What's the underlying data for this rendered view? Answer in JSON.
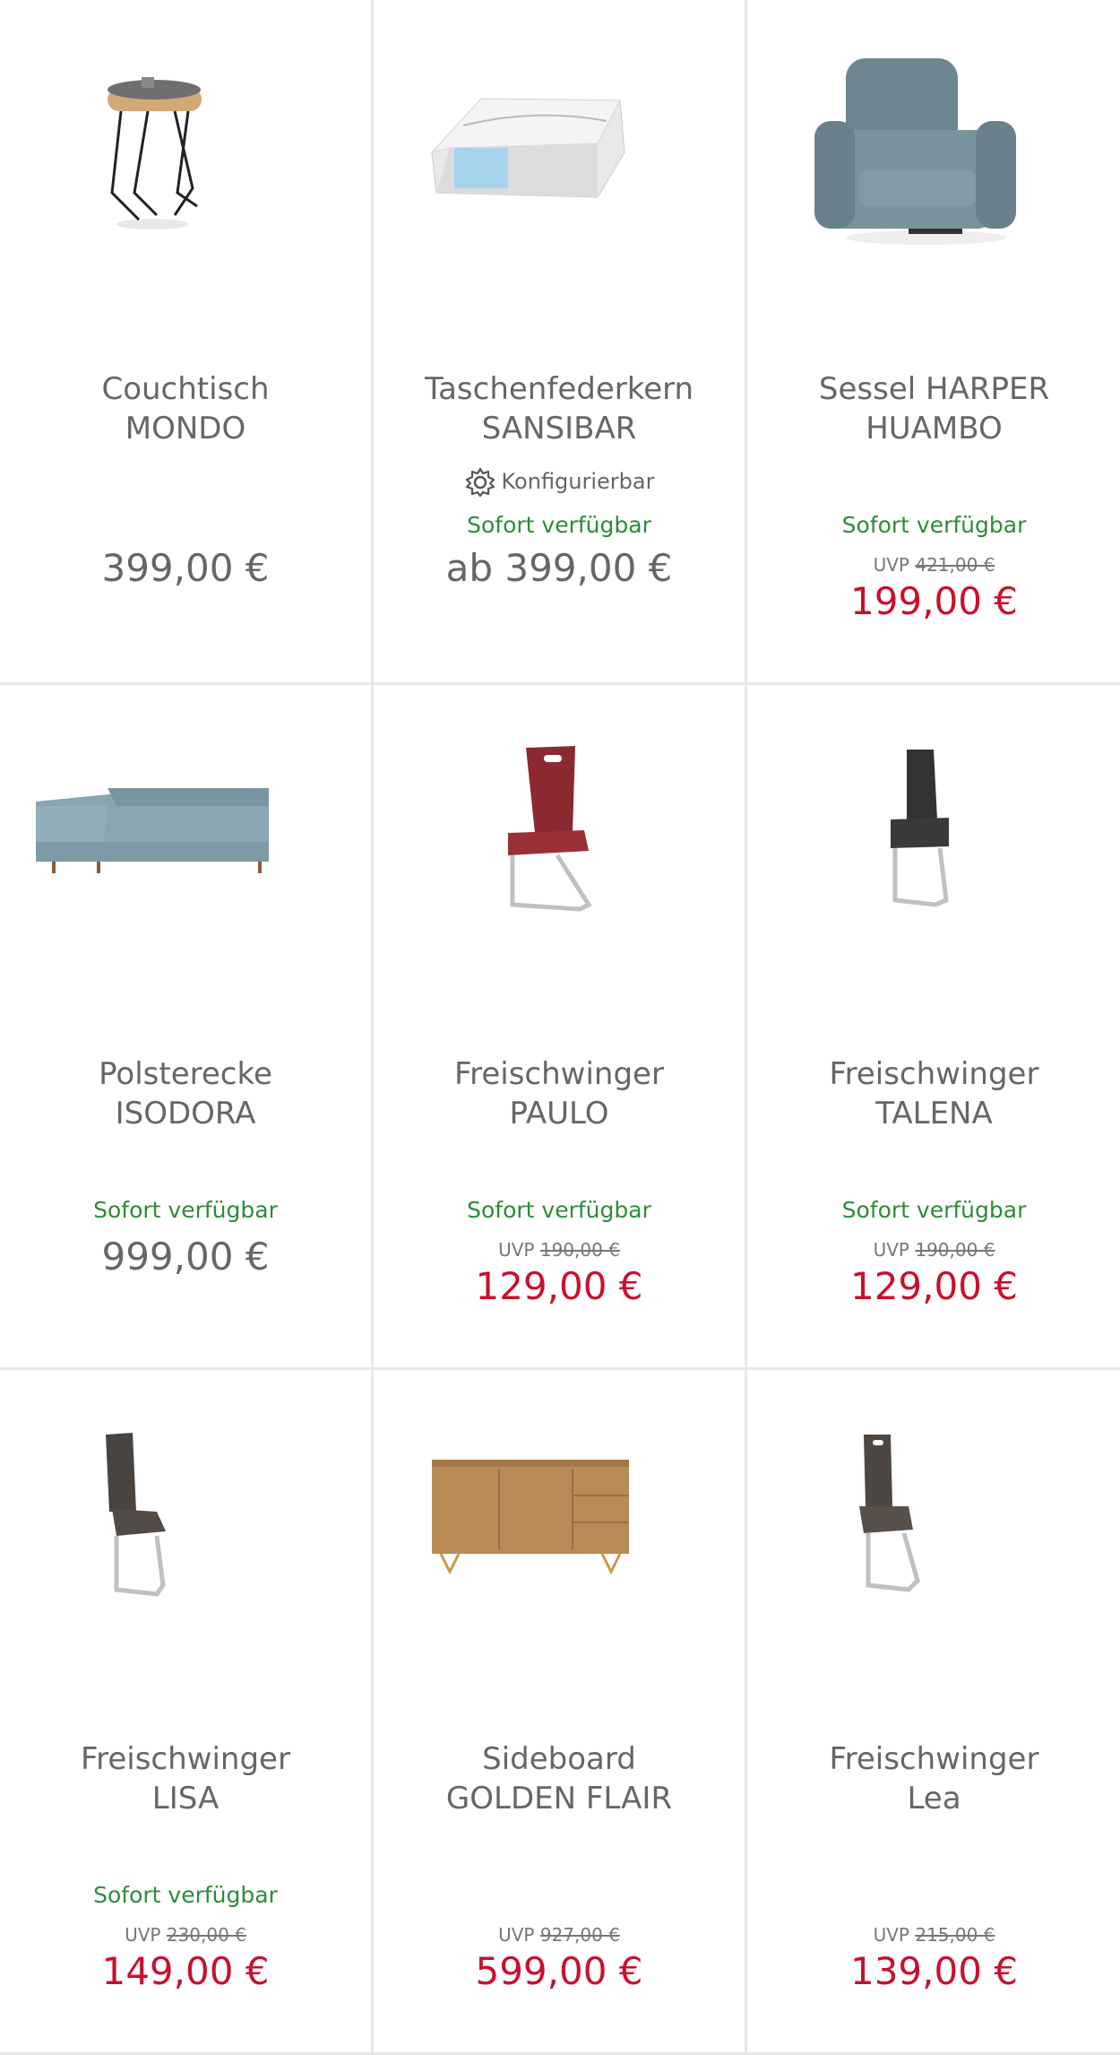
{
  "products": [
    {
      "title_line1": "Couchtisch",
      "title_line2": "MONDO",
      "config": "",
      "availability": "",
      "uvp_label": "",
      "uvp_price": "",
      "price": "399,00 €",
      "icon": "side-table-image"
    },
    {
      "title_line1": "Taschenfederkern",
      "title_line2": "SANSIBAR",
      "config": "Konfigurierbar",
      "availability": "Sofort verfügbar",
      "uvp_label": "",
      "uvp_price": "",
      "price": "ab 399,00 €",
      "icon": "mattress-image"
    },
    {
      "title_line1": "Sessel HARPER",
      "title_line2": "HUAMBO",
      "config": "",
      "availability": "Sofort verfügbar",
      "uvp_label": "UVP",
      "uvp_price": "421,00 €",
      "price": "199,00 €",
      "icon": "armchair-image"
    },
    {
      "title_line1": "Polsterecke",
      "title_line2": "ISODORA",
      "config": "",
      "availability": "Sofort verfügbar",
      "uvp_label": "",
      "uvp_price": "",
      "price": "999,00 €",
      "icon": "corner-sofa-image"
    },
    {
      "title_line1": "Freischwinger",
      "title_line2": "PAULO",
      "config": "",
      "availability": "Sofort verfügbar",
      "uvp_label": "UVP",
      "uvp_price": "190,00 €",
      "price": "129,00 €",
      "icon": "red-chair-image"
    },
    {
      "title_line1": "Freischwinger",
      "title_line2": "TALENA",
      "config": "",
      "availability": "Sofort verfügbar",
      "uvp_label": "UVP",
      "uvp_price": "190,00 €",
      "price": "129,00 €",
      "icon": "dark-chair-image"
    },
    {
      "title_line1": "Freischwinger",
      "title_line2": "LISA",
      "config": "",
      "availability": "Sofort verfügbar",
      "uvp_label": "UVP",
      "uvp_price": "230,00 €",
      "price": "149,00 €",
      "icon": "brown-chair-image"
    },
    {
      "title_line1": "Sideboard",
      "title_line2": "GOLDEN FLAIR",
      "config": "",
      "availability": "",
      "uvp_label": "UVP",
      "uvp_price": "927,00 €",
      "price": "599,00 €",
      "icon": "sideboard-image"
    },
    {
      "title_line1": "Freischwinger",
      "title_line2": "Lea",
      "config": "",
      "availability": "",
      "uvp_label": "UVP",
      "uvp_price": "215,00 €",
      "price": "139,00 €",
      "icon": "handle-chair-image"
    }
  ],
  "colors": {
    "availability": "#2e8b3a",
    "sale_price": "#c8102e",
    "text": "#666666",
    "divider": "#e8e8e8"
  }
}
